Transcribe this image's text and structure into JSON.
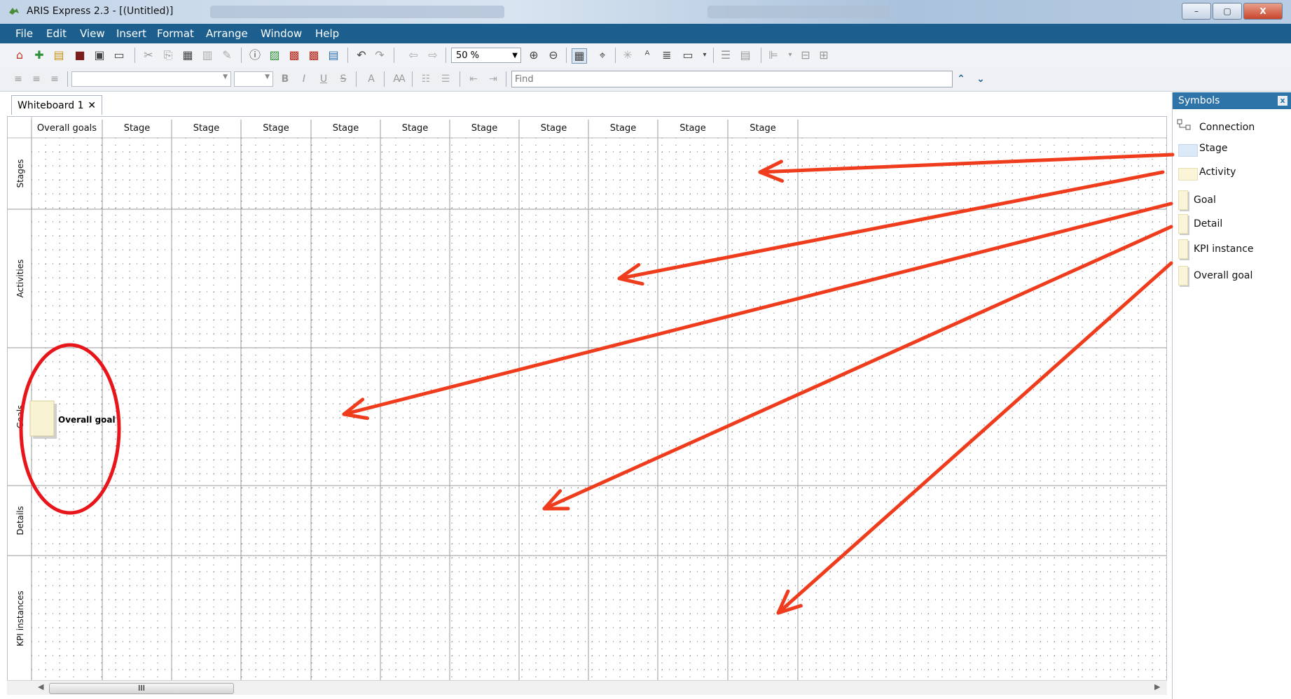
{
  "window": {
    "title": "ARIS Express 2.3 - [(Untitled)]",
    "controls": {
      "minimize": "–",
      "maximize": "▢",
      "close": "X"
    }
  },
  "menu": [
    "File",
    "Edit",
    "View",
    "Insert",
    "Format",
    "Arrange",
    "Window",
    "Help"
  ],
  "toolbar": {
    "zoom": "50 %",
    "find_placeholder": "Find",
    "bold": "B",
    "italic": "I",
    "underline": "U",
    "strike": "S"
  },
  "tab": {
    "label": "Whiteboard 1",
    "close": "✕"
  },
  "canvas": {
    "column_headers": [
      "Overall goals",
      "Stage",
      "Stage",
      "Stage",
      "Stage",
      "Stage",
      "Stage",
      "Stage",
      "Stage",
      "Stage",
      "Stage"
    ],
    "row_headers": [
      "Stages",
      "Activities",
      "Goals",
      "Details",
      "KPI instances"
    ],
    "object_label": "Overall goal",
    "scroll_thumb": "III"
  },
  "symbols_panel": {
    "title": "Symbols",
    "close": "x",
    "items": [
      "Connection",
      "Stage",
      "Activity",
      "Goal",
      "Detail",
      "KPI instance",
      "Overall goal"
    ]
  },
  "colors": {
    "menu_bar": "#1c5f8f",
    "panel_header": "#2f74a8",
    "annotation": "#ef3c1c",
    "circle": "#e8151a",
    "object_fill": "#f8f3d2"
  }
}
